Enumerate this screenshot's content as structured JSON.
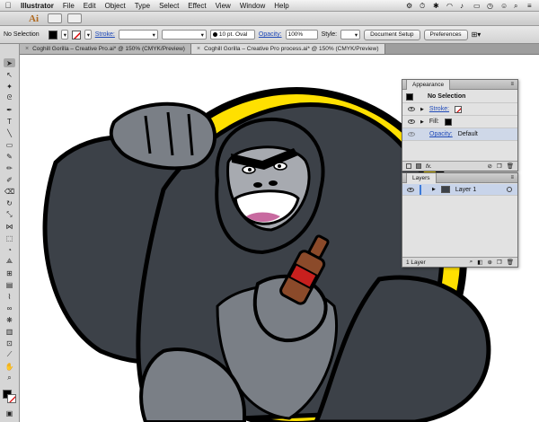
{
  "menubar": {
    "apple": "",
    "app_name": "Illustrator",
    "items": [
      "File",
      "Edit",
      "Object",
      "Type",
      "Select",
      "Effect",
      "View",
      "Window",
      "Help"
    ]
  },
  "appbar": {
    "logo": "Ai"
  },
  "controlbar": {
    "selection": "No Selection",
    "stroke_label": "Stroke:",
    "brush": "10 pt. Oval",
    "opacity_label": "Opacity:",
    "opacity_value": "100%",
    "style_label": "Style:",
    "document_setup": "Document Setup",
    "preferences": "Preferences"
  },
  "tabs": [
    {
      "label": "Coghill Gorilla – Creative Pro.ai* @ 150% (CMYK/Preview)"
    },
    {
      "label": "Coghill Gorilla – Creative Pro process.ai* @ 150% (CMYK/Preview)"
    }
  ],
  "appearance": {
    "title": "Appearance",
    "header": "No Selection",
    "stroke_label": "Stroke:",
    "fill_label": "Fill:",
    "opacity_label": "Opacity:",
    "opacity_value": "Default",
    "fx": "fx."
  },
  "layers": {
    "title": "Layers",
    "layer_name": "Layer 1",
    "footer": "1 Layer"
  },
  "colors": {
    "fur": "#3c4148",
    "fur_light": "#7a7f86",
    "face": "#a7aab0",
    "yellow": "#ffe000",
    "bottle": "#8b4a2a",
    "label": "#c8201e"
  }
}
